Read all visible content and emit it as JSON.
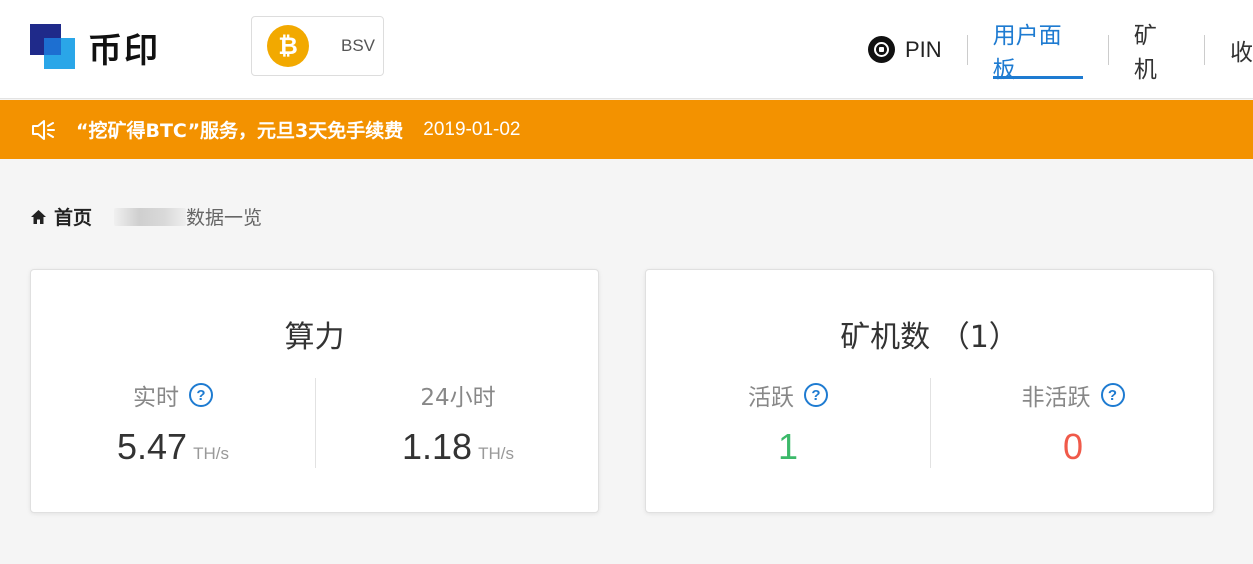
{
  "header": {
    "logo_text": "币印",
    "coin": {
      "label": "BSV",
      "icon": "bitcoin-icon",
      "color": "#f2a900"
    },
    "nav": {
      "pin_label": "PIN",
      "items": [
        {
          "label": "用户面板",
          "active": true
        },
        {
          "label": "矿机"
        },
        {
          "label": "收"
        }
      ]
    }
  },
  "notice": {
    "text": "“挖矿得BTC”服务，元旦3天免手续费",
    "date": "2019-01-02",
    "color": "#f39200"
  },
  "breadcrumb": {
    "home": "首页",
    "page": "数据一览"
  },
  "hashrate_card": {
    "title": "算力",
    "realtime_label": "实时",
    "realtime_value": "5.47",
    "realtime_unit": "TH/s",
    "day_label": "24小时",
    "day_value": "1.18",
    "day_unit": "TH/s"
  },
  "miners_card": {
    "title": "矿机数 （1）",
    "active_label": "活跃",
    "active_value": "1",
    "inactive_label": "非活跃",
    "inactive_value": "0"
  },
  "colors": {
    "accent": "#1e7bd1",
    "active_green": "#3cb96a",
    "inactive_red": "#f05a4a"
  }
}
